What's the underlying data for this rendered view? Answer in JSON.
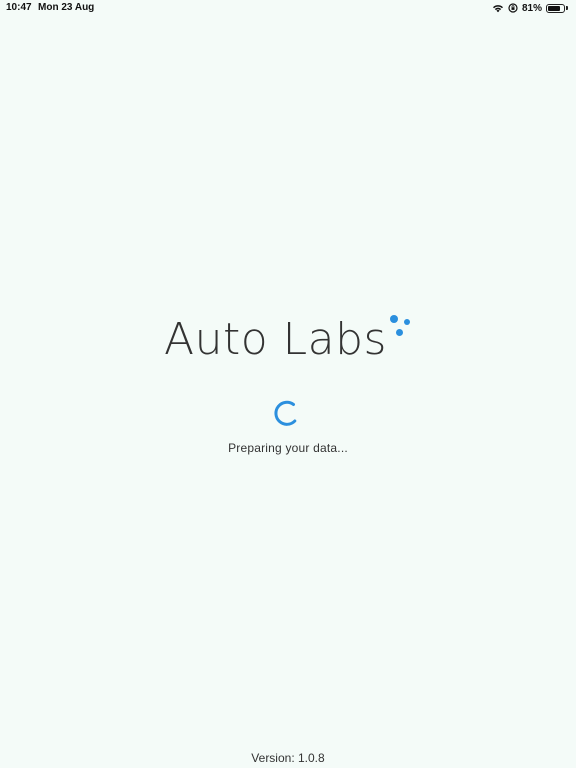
{
  "status_bar": {
    "time": "10:47",
    "date": "Mon 23 Aug",
    "battery_percent": "81%",
    "battery_level": 0.81,
    "icons": [
      "wifi-icon",
      "orientation-lock-icon",
      "battery-icon"
    ]
  },
  "splash": {
    "logo_text": "Auto Labs",
    "loading_message": "Preparing your data...",
    "version": "Version: 1.0.8"
  },
  "colors": {
    "background": "#f4fbf8",
    "accent": "#2b8fde",
    "text": "#333333"
  }
}
